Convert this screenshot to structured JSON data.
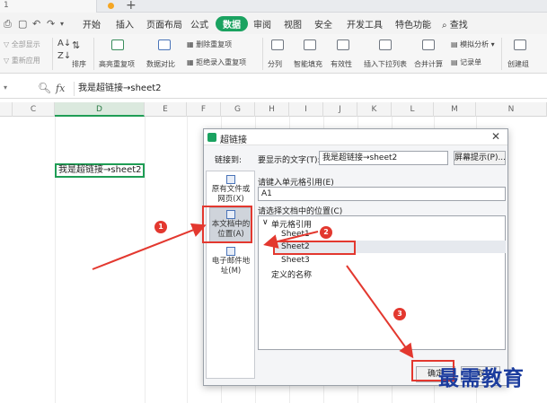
{
  "tabstrip": {
    "tab_label": "1"
  },
  "menu": {
    "tabs": [
      "开始",
      "插入",
      "页面布局",
      "公式",
      "数据",
      "审阅",
      "视图",
      "安全",
      "开发工具",
      "特色功能"
    ],
    "active": "数据",
    "search": "查找"
  },
  "ribbon": {
    "show_all": "全部显示",
    "reapply": "重新应用",
    "sort": "排序",
    "highlight_dup": "高亮重复项",
    "data_compare": "数据对比",
    "remove_dup": "删除重复项",
    "reject_dup": "拒绝录入重复项",
    "split_col": "分列",
    "smart_fill": "智能填充",
    "validity": "有效性",
    "insert_dropdown": "插入下拉列表",
    "merge_calc": "合并计算",
    "simulate": "模拟分析",
    "record": "记录单",
    "create_group": "创建组"
  },
  "formula_bar": {
    "content": "我是超链接→sheet2"
  },
  "columns": [
    "C",
    "D",
    "E",
    "F",
    "G",
    "H",
    "I",
    "J",
    "K",
    "L",
    "M",
    "N"
  ],
  "cell_text": "我是超链接→sheet2",
  "dialog": {
    "title": "超链接",
    "link_to": "链接到:",
    "display_text_label": "要显示的文字(T):",
    "display_text_value": "我是超链接→sheet2",
    "screen_tip": "屏幕提示(P)...",
    "cell_ref_label": "请键入单元格引用(E)",
    "cell_ref_value": "A1",
    "location_label": "请选择文档中的位置(C)",
    "nav_items": [
      {
        "label": "原有文件或网页(X)"
      },
      {
        "label": "本文档中的位置(A)"
      },
      {
        "label": "电子邮件地址(M)"
      }
    ],
    "tree": {
      "root": "单元格引用",
      "sheets": [
        "Sheet1",
        "Sheet2",
        "Sheet3"
      ],
      "defined_names": "定义的名称"
    },
    "ok": "确定",
    "cancel": "取"
  },
  "badges": [
    "1",
    "2",
    "3"
  ],
  "watermark": "最需教育",
  "colors": {
    "accent_green": "#1aa260",
    "annotation_red": "#e3382f",
    "watermark_blue": "#1b3c9e"
  }
}
